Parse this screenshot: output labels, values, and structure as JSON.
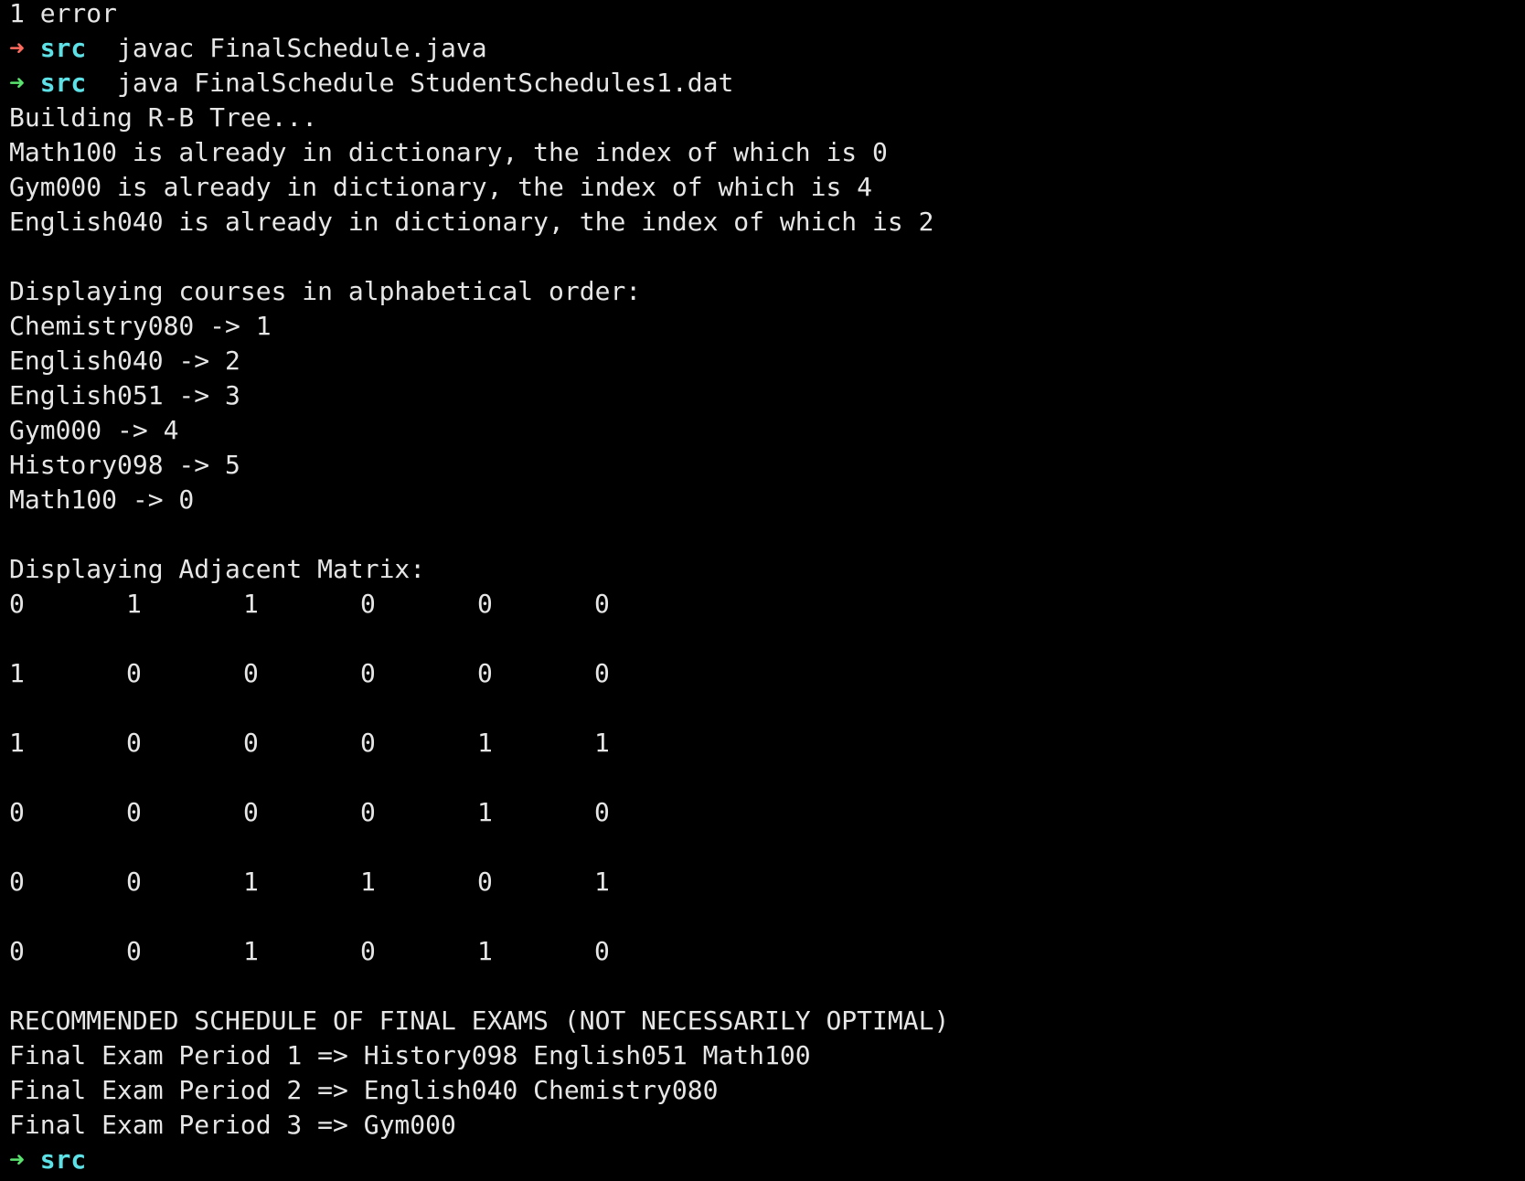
{
  "colors": {
    "background": "#000000",
    "text": "#e6e6e6",
    "prompt_arrow_error": "#ff6b5e",
    "prompt_arrow_ok": "#59e36e",
    "prompt_dir": "#5ee1e6"
  },
  "icons": {
    "prompt_arrow": "right-arrow-icon"
  },
  "terminal": {
    "error_line": "1 error",
    "prompt_arrow_glyph": "➜",
    "prompt_dir": "src",
    "cmd1": "javac FinalSchedule.java",
    "cmd2": "java FinalSchedule StudentSchedules1.dat",
    "building": "Building R-B Tree...",
    "dupes": [
      "Math100 is already in dictionary, the index of which is 0",
      "Gym000 is already in dictionary, the index of which is 4",
      "English040 is already in dictionary, the index of which is 2"
    ],
    "courses_header": "Displaying courses in alphabetical order:",
    "courses": [
      "Chemistry080 -> 1",
      "English040 -> 2",
      "English051 -> 3",
      "Gym000 -> 4",
      "History098 -> 5",
      "Math100 -> 0"
    ],
    "matrix_header": "Displaying Adjacent Matrix:",
    "matrix": [
      [
        "0",
        "1",
        "1",
        "0",
        "0",
        "0"
      ],
      [
        "1",
        "0",
        "0",
        "0",
        "0",
        "0"
      ],
      [
        "1",
        "0",
        "0",
        "0",
        "1",
        "1"
      ],
      [
        "0",
        "0",
        "0",
        "0",
        "1",
        "0"
      ],
      [
        "0",
        "0",
        "1",
        "1",
        "0",
        "1"
      ],
      [
        "0",
        "0",
        "1",
        "0",
        "1",
        "0"
      ]
    ],
    "schedule_header": "RECOMMENDED SCHEDULE OF FINAL EXAMS (NOT NECESSARILY OPTIMAL)",
    "schedule": [
      "Final Exam Period 1 => History098 English051 Math100",
      "Final Exam Period 2 => English040 Chemistry080",
      "Final Exam Period 3 => Gym000"
    ]
  }
}
